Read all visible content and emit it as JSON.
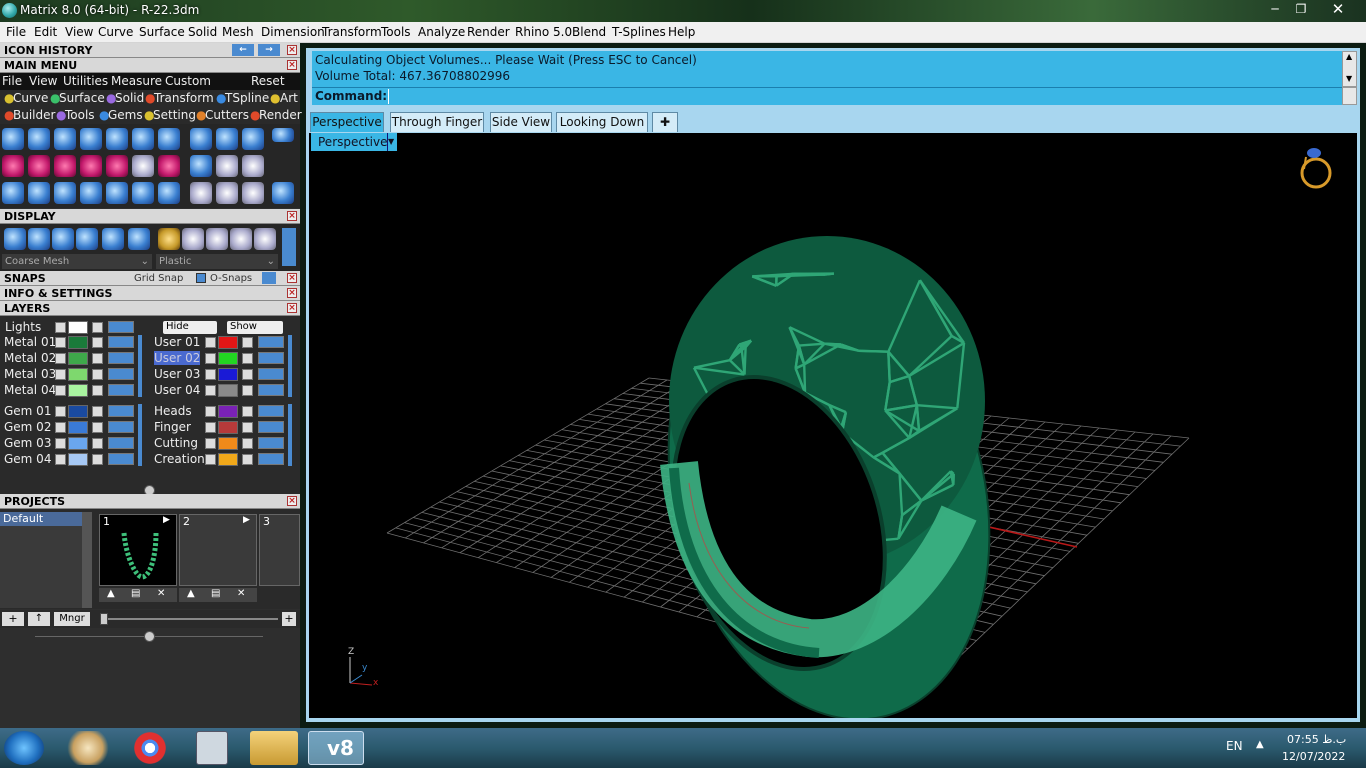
{
  "window": {
    "title": "Matrix 8.0 (64-bit) - R-22.3dm"
  },
  "menubar": [
    "File",
    "Edit",
    "View",
    "Curve",
    "Surface",
    "Solid",
    "Mesh",
    "Dimension",
    "Transform",
    "Tools",
    "Analyze",
    "Render",
    "Rhino 5.0",
    "Blend",
    "T-Splines",
    "Help"
  ],
  "panels": {
    "icon_history": "ICON HISTORY",
    "main_menu": "MAIN MENU",
    "main_menu_items": [
      "File",
      "View",
      "Utilities",
      "Measure",
      "Custom"
    ],
    "reset": "Reset",
    "category_row1": [
      "Curve",
      "Surface",
      "Solid",
      "Transform",
      "TSpline",
      "Art"
    ],
    "category_row2": [
      "Builder",
      "Tools",
      "Gems",
      "Setting",
      "Cutters",
      "Render"
    ],
    "display": "DISPLAY",
    "display_mesh": "Coarse Mesh",
    "display_material": "Plastic",
    "snaps": "SNAPS",
    "grid_snap": "Grid Snap",
    "o_snaps": "O-Snaps",
    "info": "INFO & SETTINGS",
    "layers": "LAYERS",
    "projects": "PROJECTS",
    "mngr": "Mngr"
  },
  "layers": {
    "lights": "Lights",
    "hide": "Hide",
    "show": "Show",
    "metal": [
      {
        "name": "Metal 01",
        "color": "#1a7a3a"
      },
      {
        "name": "Metal 02",
        "color": "#3ea84a"
      },
      {
        "name": "Metal 03",
        "color": "#7ed86e"
      },
      {
        "name": "Metal 04",
        "color": "#a9f4a0"
      }
    ],
    "user": [
      {
        "name": "User 01",
        "color": "#e21616"
      },
      {
        "name": "User 02",
        "color": "#22d622"
      },
      {
        "name": "User 03",
        "color": "#1a1ad6"
      },
      {
        "name": "User 04",
        "color": "#8a8a8a"
      }
    ],
    "gem": [
      {
        "name": "Gem 01",
        "color": "#1a4aa0"
      },
      {
        "name": "Gem 02",
        "color": "#3a7ad6"
      },
      {
        "name": "Gem 03",
        "color": "#6aa6ee"
      },
      {
        "name": "Gem 04",
        "color": "#a6c8f4"
      }
    ],
    "special": [
      {
        "name": "Heads",
        "color": "#7a22b6"
      },
      {
        "name": "Finger",
        "color": "#b63a3a"
      },
      {
        "name": "Cutting",
        "color": "#f08a1a"
      },
      {
        "name": "Creation",
        "color": "#f0a81a"
      }
    ],
    "selected": "User 02"
  },
  "projects": {
    "list": [
      "Default"
    ],
    "slots": [
      "1",
      "2",
      "3"
    ]
  },
  "command": {
    "line1": "Calculating Object Volumes... Please Wait (Press ESC to Cancel)",
    "line2": "Volume Total: 467.36708802996",
    "prompt": "Command:"
  },
  "tabs": [
    "Perspective",
    "Through Finger",
    "Side View",
    "Looking Down"
  ],
  "active_tab": "Perspective",
  "viewport_label": "Perspective",
  "axes": {
    "z": "Z",
    "y": "y",
    "x": "x"
  },
  "taskbar": {
    "language": "EN",
    "time": "07:55 ب.ظ",
    "date": "12/07/2022",
    "apps": [
      "start",
      "paint",
      "chrome",
      "calculator",
      "explorer",
      "matrix"
    ],
    "matrix_label": "v8"
  },
  "colors": {
    "accent": "#3ab6e5",
    "ring": "#0f6b4a"
  }
}
